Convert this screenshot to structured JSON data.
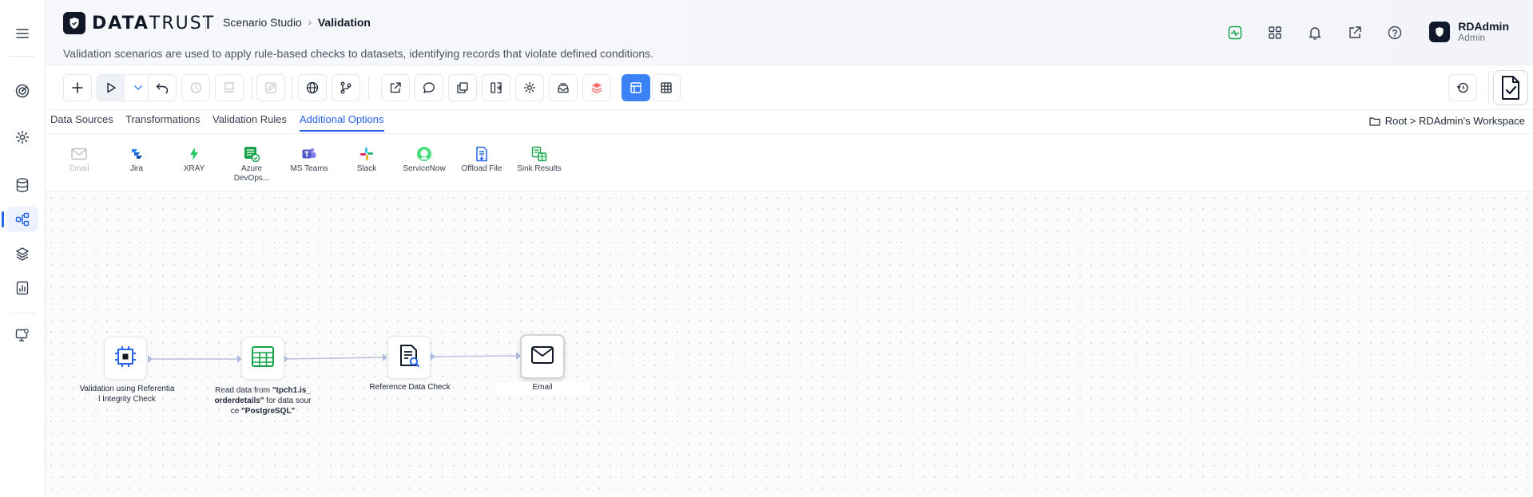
{
  "header": {
    "brand_bold": "DATA",
    "brand_light": "TRUST",
    "breadcrumb_parent": "Scenario Studio",
    "breadcrumb_current": "Validation",
    "subtitle": "Validation scenarios are used to apply rule-based checks to datasets, identifying records that violate defined conditions.",
    "user_name": "RDAdmin",
    "user_role": "Admin",
    "icons": [
      "activity-icon",
      "apps-grid-icon",
      "bell-icon",
      "external-link-icon",
      "help-icon"
    ]
  },
  "rail": {
    "items": [
      "menu-icon",
      "target-icon",
      "settings-icon",
      "database-icon",
      "workflow-icon",
      "layers-icon",
      "report-icon",
      "monitor-settings-icon"
    ],
    "active": "workflow-icon"
  },
  "tabs": {
    "items": [
      "Data Sources",
      "Transformations",
      "Validation Rules",
      "Additional Options"
    ],
    "active_index": 3,
    "workspace_path": "Root > RDAdmin's Workspace"
  },
  "palette": {
    "items": [
      {
        "label": "Email",
        "icon": "mail-icon",
        "enabled": false
      },
      {
        "label": "Jira",
        "icon": "jira-icon",
        "enabled": true
      },
      {
        "label": "XRAY",
        "icon": "xray-icon",
        "enabled": true
      },
      {
        "label": "Azure DevOps...",
        "icon": "azure-devops-icon",
        "enabled": true
      },
      {
        "label": "MS Teams",
        "icon": "ms-teams-icon",
        "enabled": true
      },
      {
        "label": "Slack",
        "icon": "slack-icon",
        "enabled": true
      },
      {
        "label": "ServiceNow",
        "icon": "servicenow-icon",
        "enabled": true
      },
      {
        "label": "Offload File",
        "icon": "offload-file-icon",
        "enabled": true
      },
      {
        "label": "Sink Results",
        "icon": "sink-results-icon",
        "enabled": true
      }
    ]
  },
  "canvas": {
    "nodes": [
      {
        "id": "n1",
        "label_line1": "Validation using Referentia",
        "label_line2": "l Integrity Check",
        "icon": "referential-integrity-icon"
      },
      {
        "id": "n2",
        "label_pre": "Read data from ",
        "label_bold1": "\"tpch1.is_",
        "label_bold2": "orderdetails\"",
        "label_mid": " for data sour",
        "label_line3_pre": "ce ",
        "label_bold3": "\"PostgreSQL\"",
        "icon": "table-icon"
      },
      {
        "id": "n3",
        "label_line1": "Reference Data Check",
        "icon": "reference-check-icon"
      },
      {
        "id": "n4",
        "label_line1": "Email",
        "icon": "mail-icon",
        "selected": true
      }
    ]
  },
  "colors": {
    "accent": "#2563eb",
    "brand_dark": "#111827",
    "success_green": "#16a34a"
  }
}
